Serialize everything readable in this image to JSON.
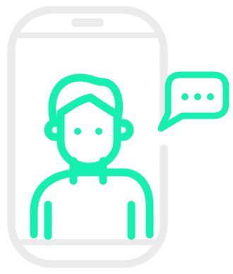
{
  "illustration": {
    "subject": "person-chatting-on-smartphone",
    "colors": {
      "phone_outline": "#ebebeb",
      "accent": "#13f0b0",
      "background": "#ffffff"
    },
    "icons": [
      "smartphone-icon",
      "person-icon",
      "speech-bubble-icon",
      "ellipsis-icon"
    ]
  }
}
